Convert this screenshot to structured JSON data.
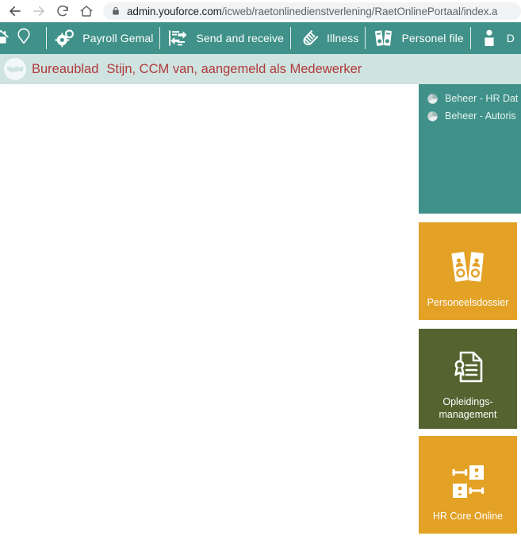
{
  "browser": {
    "back_icon": "arrow-left-icon",
    "forward_icon": "arrow-right-icon",
    "reload_icon": "reload-icon",
    "home_icon": "home-icon",
    "lock_icon": "lock-icon",
    "url_host": "admin.youforce.com",
    "url_path": "/icweb/raetonlinedienstverlening/RaetOnlinePortaal/index.a"
  },
  "app_nav": {
    "home_icon": "home-icon",
    "pin_icon": "location-pin-icon",
    "items": [
      {
        "label": "Payroll Gemal",
        "icon": "gears-icon"
      },
      {
        "label": "Send and receive",
        "icon": "exchange-arrows-icon"
      },
      {
        "label": "Illness",
        "icon": "thermometer-icon"
      },
      {
        "label": "Personel file",
        "icon": "binders-icon"
      },
      {
        "label": "D",
        "icon": "person-icon"
      }
    ]
  },
  "desktop_bar": {
    "icon": "handshake-icon",
    "title": "Bureaublad",
    "user_status": "Stijn, CCM van, aangemeld als Medewerker"
  },
  "links_panel": {
    "background": "#3f9189",
    "items": [
      {
        "label": "Beheer - HR Dat",
        "icon": "pie-chart-icon"
      },
      {
        "label": "Beheer - Autoris",
        "icon": "pie-chart-icon"
      }
    ]
  },
  "tiles": [
    {
      "label": "Personeelsdossier",
      "icon": "binders-icon",
      "color": "#e3a126"
    },
    {
      "label": "Opleidings-\nmanagement",
      "icon": "certificate-icon",
      "color": "#54632f"
    },
    {
      "label": "HR Core Online",
      "icon": "org-chart-icon",
      "color": "#e3a126"
    }
  ],
  "colors": {
    "teal": "#3f9189",
    "teal_light": "#cfe3e0",
    "orange": "#e3a126",
    "olive": "#54632f",
    "red_text": "#b03a3a"
  }
}
